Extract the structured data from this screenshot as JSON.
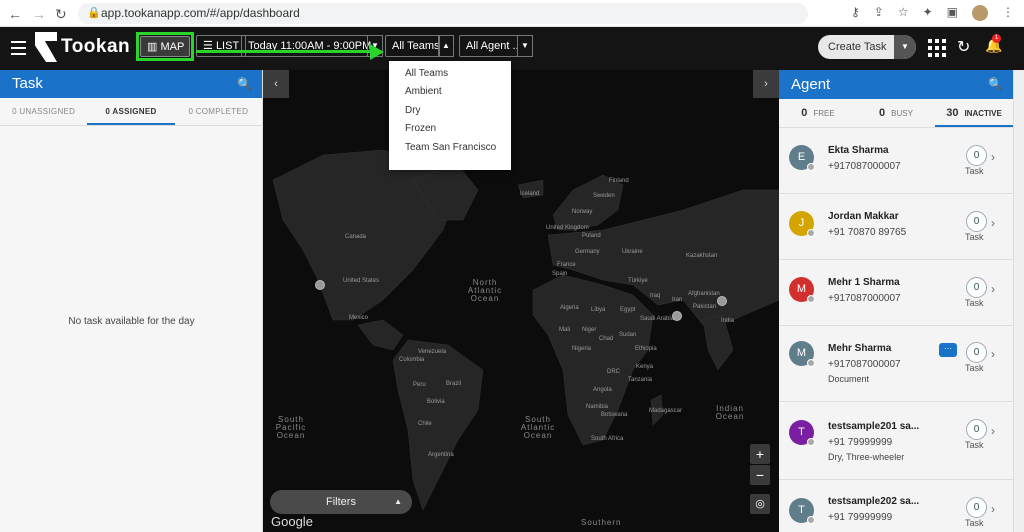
{
  "browser": {
    "back_icon": "arrow-left-icon",
    "forward_icon": "arrow-right-icon",
    "reload_icon": "reload-icon",
    "url": "app.tookanapp.com/#/app/dashboard"
  },
  "header": {
    "brand": "Tookan",
    "map_label": "MAP",
    "list_label": "LIST",
    "date_range": "Today 11:00AM - 9:00PM",
    "team_filter": "All Teams",
    "agent_filter": "All Agent ..",
    "create_task": "Create Task",
    "notification_count": "1"
  },
  "team_dropdown": {
    "options": [
      "All Teams",
      "Ambient",
      "Dry",
      "Frozen",
      "Team San Francisco"
    ]
  },
  "task_panel": {
    "title": "Task",
    "tabs": [
      "0 UNASSIGNED",
      "0 ASSIGNED",
      "0 COMPLETED"
    ],
    "empty_message": "No task available for the day"
  },
  "map": {
    "labels": [
      "Canada",
      "United States",
      "Mexico",
      "Venezuela",
      "Colombia",
      "Peru",
      "Brazil",
      "Bolivia",
      "Chile",
      "Argentina",
      "Iceland",
      "Finland",
      "Sweden",
      "Norway",
      "United Kingdom",
      "Poland",
      "Germany",
      "France",
      "Spain",
      "Ukraine",
      "Kazakhstan",
      "Türkiye",
      "Iraq",
      "Iran",
      "Afghanistan",
      "Pakistan",
      "India",
      "Algeria",
      "Libya",
      "Egypt",
      "Saudi Arabia",
      "Mali",
      "Niger",
      "Chad",
      "Sudan",
      "Ethiopia",
      "Nigeria",
      "DRC",
      "Kenya",
      "Tanzania",
      "Angola",
      "Namibia",
      "Botswana",
      "Madagascar",
      "South Africa"
    ],
    "oceans": [
      "North Atlantic Ocean",
      "South Pacific Ocean",
      "South Atlantic Ocean",
      "Indian Ocean",
      "Southern"
    ],
    "filters_label": "Filters",
    "attribution": "Google",
    "zoom_in": "+",
    "zoom_out": "−"
  },
  "agent_panel": {
    "title": "Agent",
    "tabs": [
      {
        "count": "0",
        "label": "FREE"
      },
      {
        "count": "0",
        "label": "BUSY"
      },
      {
        "count": "30",
        "label": "INACTIVE"
      }
    ],
    "task_label": "Task",
    "agents": [
      {
        "initial": "E",
        "name": "Ekta Sharma",
        "phone": "+917087000007",
        "extra": "",
        "count": "0",
        "color": "#607d8b"
      },
      {
        "initial": "J",
        "name": "Jordan Makkar",
        "phone": "+91 70870 89765",
        "extra": "",
        "count": "0",
        "color": "#d4a500"
      },
      {
        "initial": "M",
        "name": "Mehr 1 Sharma",
        "phone": "+917087000007",
        "extra": "",
        "count": "0",
        "color": "#d32f2f"
      },
      {
        "initial": "M",
        "name": "Mehr Sharma",
        "phone": "+917087000007",
        "extra": "Document",
        "count": "0",
        "color": "#607d8b"
      },
      {
        "initial": "T",
        "name": "testsample201 sa...",
        "phone": "+91 79999999",
        "extra": "Dry, Three-wheeler",
        "count": "0",
        "color": "#7b1fa2"
      },
      {
        "initial": "T",
        "name": "testsample202 sa...",
        "phone": "+91 79999999",
        "extra": "",
        "count": "0",
        "color": "#607d8b"
      }
    ]
  },
  "colors": {
    "accent_blue": "#1a73c9",
    "highlight_green": "#29d42b",
    "map_bg": "#0c0c0c"
  }
}
